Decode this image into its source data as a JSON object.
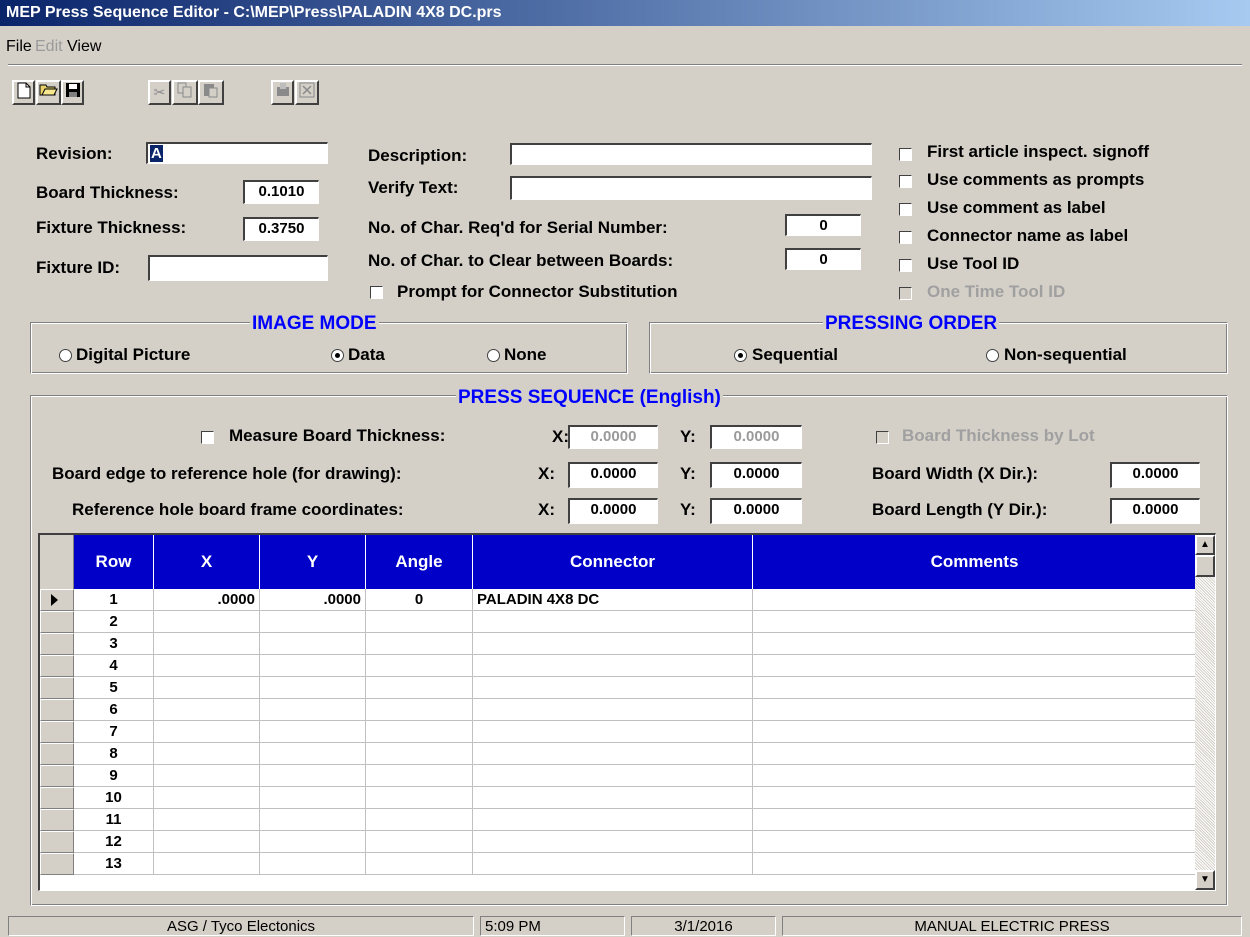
{
  "window": {
    "title": "MEP Press Sequence Editor - C:\\MEP\\Press\\PALADIN 4X8 DC.prs"
  },
  "menu": {
    "file": "File",
    "edit": "Edit",
    "view": "View"
  },
  "toolbar": {
    "new_icon": "new-document-icon",
    "open_icon": "open-folder-icon",
    "save_icon": "save-disk-icon",
    "cut_icon": "cut-icon",
    "copy_icon": "copy-icon",
    "paste_icon": "paste-icon",
    "insert_row_icon": "insert-row-icon",
    "delete_row_icon": "delete-row-icon"
  },
  "header": {
    "revision_label": "Revision:",
    "revision_value": "A",
    "board_thickness_label": "Board Thickness:",
    "board_thickness_value": "0.1010",
    "fixture_thickness_label": "Fixture Thickness:",
    "fixture_thickness_value": "0.3750",
    "fixture_id_label": "Fixture ID:",
    "fixture_id_value": "",
    "description_label": "Description:",
    "description_value": "",
    "verify_text_label": "Verify Text:",
    "verify_text_value": "",
    "serial_chars_label": "No. of Char. Req'd for Serial Number:",
    "serial_chars_value": "0",
    "clear_chars_label": "No. of Char. to Clear between Boards:",
    "clear_chars_value": "0",
    "prompt_substitution_label": "Prompt for Connector Substitution"
  },
  "options": {
    "first_article": "First article inspect. signoff",
    "comments_prompts": "Use comments as prompts",
    "comment_label": "Use comment as label",
    "connector_name_label": "Connector name as label",
    "use_tool_id": "Use Tool ID",
    "one_time_tool_id": "One Time Tool ID"
  },
  "image_mode": {
    "title": "IMAGE MODE",
    "digital_picture": "Digital Picture",
    "data": "Data",
    "none": "None",
    "selected": "Data"
  },
  "pressing_order": {
    "title": "PRESSING ORDER",
    "sequential": "Sequential",
    "non_sequential": "Non-sequential",
    "selected": "Sequential"
  },
  "press_sequence": {
    "title": "PRESS SEQUENCE (English)",
    "measure_board_label": "Measure Board Thickness:",
    "board_edge_label": "Board edge to reference hole (for drawing):",
    "ref_hole_label": "Reference hole board frame coordinates:",
    "x_label": "X:",
    "y_label": "Y:",
    "measure_x": "0.0000",
    "measure_y": "0.0000",
    "edge_x": "0.0000",
    "edge_y": "0.0000",
    "ref_x": "0.0000",
    "ref_y": "0.0000",
    "thickness_by_lot_label": "Board Thickness by Lot",
    "board_width_label": "Board Width (X Dir.):",
    "board_width_value": "0.0000",
    "board_length_label": "Board Length (Y Dir.):",
    "board_length_value": "0.0000"
  },
  "grid": {
    "columns": [
      "Row",
      "X",
      "Y",
      "Angle",
      "Connector",
      "Comments"
    ],
    "rows": [
      {
        "row": "1",
        "x": ".0000",
        "y": ".0000",
        "angle": "0",
        "connector": "PALADIN 4X8 DC",
        "comments": ""
      },
      {
        "row": "2",
        "x": "",
        "y": "",
        "angle": "",
        "connector": "",
        "comments": ""
      },
      {
        "row": "3",
        "x": "",
        "y": "",
        "angle": "",
        "connector": "",
        "comments": ""
      },
      {
        "row": "4",
        "x": "",
        "y": "",
        "angle": "",
        "connector": "",
        "comments": ""
      },
      {
        "row": "5",
        "x": "",
        "y": "",
        "angle": "",
        "connector": "",
        "comments": ""
      },
      {
        "row": "6",
        "x": "",
        "y": "",
        "angle": "",
        "connector": "",
        "comments": ""
      },
      {
        "row": "7",
        "x": "",
        "y": "",
        "angle": "",
        "connector": "",
        "comments": ""
      },
      {
        "row": "8",
        "x": "",
        "y": "",
        "angle": "",
        "connector": "",
        "comments": ""
      },
      {
        "row": "9",
        "x": "",
        "y": "",
        "angle": "",
        "connector": "",
        "comments": ""
      },
      {
        "row": "10",
        "x": "",
        "y": "",
        "angle": "",
        "connector": "",
        "comments": ""
      },
      {
        "row": "11",
        "x": "",
        "y": "",
        "angle": "",
        "connector": "",
        "comments": ""
      },
      {
        "row": "12",
        "x": "",
        "y": "",
        "angle": "",
        "connector": "",
        "comments": ""
      },
      {
        "row": "13",
        "x": "",
        "y": "",
        "angle": "",
        "connector": "",
        "comments": ""
      }
    ],
    "current_row_icon": "current-row-arrow-icon",
    "scroll_up_icon": "scroll-up-arrow-icon",
    "scroll_down_icon": "scroll-down-arrow-icon"
  },
  "status": {
    "company": "ASG / Tyco Electonics",
    "time": "5:09 PM",
    "date": "3/1/2016",
    "mode": "MANUAL ELECTRIC PRESS"
  }
}
